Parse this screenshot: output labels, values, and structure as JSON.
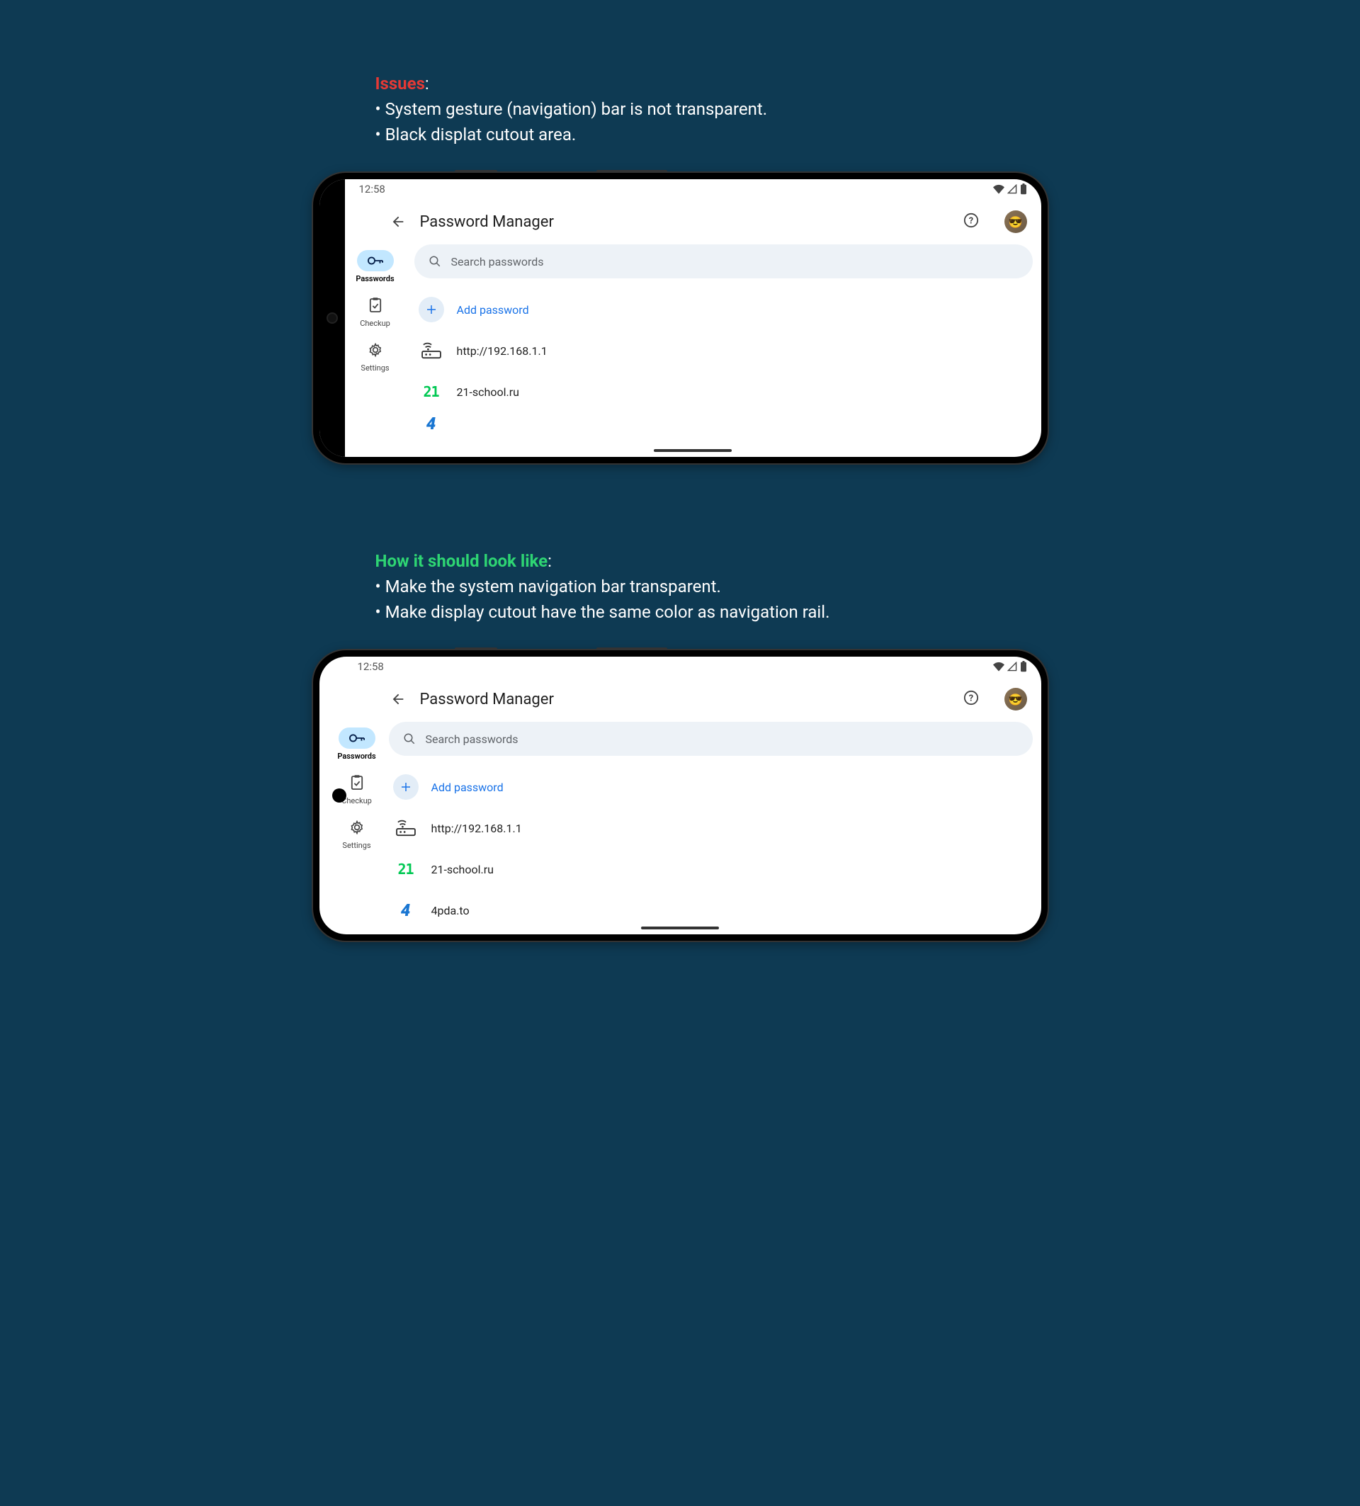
{
  "issues": {
    "title": "Issues",
    "bullets": [
      "System gesture (navigation) bar is not transparent.",
      "Black displat cutout area."
    ]
  },
  "howto": {
    "title": "How it should look like",
    "bullets": [
      "Make the system navigation bar transparent.",
      "Make display cutout have the same color as navigation rail."
    ]
  },
  "phone": {
    "time": "12:58",
    "pageTitle": "Password Manager",
    "search": {
      "placeholder": "Search passwords"
    },
    "nav": {
      "passwords": "Passwords",
      "checkup": "Checkup",
      "settings": "Settings"
    },
    "add": "Add password",
    "items": [
      {
        "label": "http://192.168.1.1"
      },
      {
        "label": "21-school.ru"
      },
      {
        "label": "4pda.to"
      }
    ]
  }
}
